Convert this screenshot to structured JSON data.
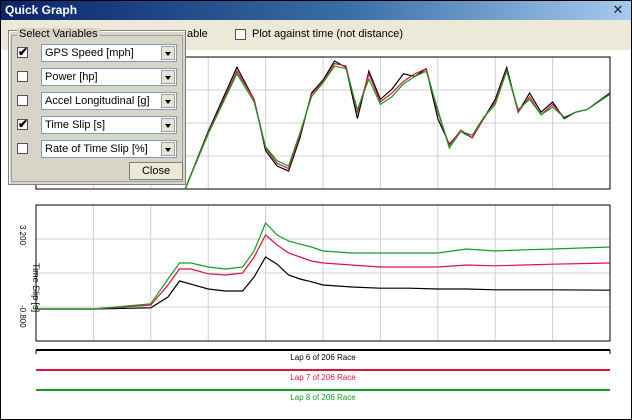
{
  "window": {
    "title": "Quick Graph",
    "close_glyph": "✕"
  },
  "toolbar": {
    "left_label_tail": "able",
    "time_checkbox_label": "Plot against time (not distance)",
    "time_checked": false
  },
  "select_panel": {
    "legend": "Select Variables",
    "variables": [
      {
        "label": "GPS Speed [mph]",
        "checked": true
      },
      {
        "label": "Power [hp]",
        "checked": false
      },
      {
        "label": "Accel Longitudinal [g]",
        "checked": false
      },
      {
        "label": "Time Slip [s]",
        "checked": true
      },
      {
        "label": "Rate of Time Slip [%]",
        "checked": false
      }
    ],
    "close_label": "Close"
  },
  "colors": {
    "lap6": "#000000",
    "lap7": "#e01040",
    "lap8": "#10a020"
  },
  "chart_data": [
    {
      "type": "line",
      "title": "",
      "ylabel": "",
      "series": [
        {
          "name": "Lap 6 of 206 Race",
          "color": "#000000",
          "x": [
            0.26,
            0.3,
            0.35,
            0.38,
            0.4,
            0.42,
            0.44,
            0.46,
            0.48,
            0.5,
            0.52,
            0.54,
            0.56,
            0.58,
            0.6,
            0.62,
            0.64,
            0.66,
            0.68,
            0.7,
            0.72,
            0.74,
            0.76,
            0.78,
            0.8,
            0.82,
            0.84,
            0.86,
            0.88,
            0.9,
            0.92,
            0.94,
            0.96,
            1.0
          ],
          "y": [
            0.0,
            0.45,
            0.95,
            0.7,
            0.3,
            0.18,
            0.14,
            0.4,
            0.75,
            0.85,
            1.0,
            0.95,
            0.55,
            0.92,
            0.7,
            0.78,
            0.9,
            0.88,
            0.94,
            0.55,
            0.35,
            0.45,
            0.4,
            0.55,
            0.7,
            0.95,
            0.6,
            0.75,
            0.6,
            0.68,
            0.55,
            0.6,
            0.62,
            0.75
          ]
        },
        {
          "name": "Lap 7 of 206 Race",
          "color": "#e01040",
          "x": [
            0.26,
            0.3,
            0.35,
            0.38,
            0.4,
            0.42,
            0.44,
            0.46,
            0.48,
            0.5,
            0.52,
            0.54,
            0.56,
            0.58,
            0.6,
            0.62,
            0.64,
            0.66,
            0.68,
            0.7,
            0.72,
            0.74,
            0.76,
            0.78,
            0.8,
            0.82,
            0.84,
            0.86,
            0.88,
            0.9,
            0.92,
            0.94,
            0.96,
            1.0
          ],
          "y": [
            0.0,
            0.44,
            0.92,
            0.7,
            0.32,
            0.2,
            0.16,
            0.42,
            0.74,
            0.84,
            0.98,
            0.96,
            0.6,
            0.9,
            0.68,
            0.75,
            0.84,
            0.9,
            0.94,
            0.6,
            0.34,
            0.46,
            0.4,
            0.55,
            0.68,
            0.93,
            0.6,
            0.72,
            0.58,
            0.66,
            0.56,
            0.6,
            0.62,
            0.74
          ]
        },
        {
          "name": "Lap 8 of 206 Race",
          "color": "#10a020",
          "x": [
            0.26,
            0.3,
            0.35,
            0.38,
            0.4,
            0.42,
            0.44,
            0.46,
            0.48,
            0.5,
            0.52,
            0.54,
            0.56,
            0.58,
            0.6,
            0.62,
            0.64,
            0.66,
            0.68,
            0.7,
            0.72,
            0.74,
            0.76,
            0.78,
            0.8,
            0.82,
            0.84,
            0.86,
            0.88,
            0.9,
            0.92,
            0.94,
            0.96,
            1.0
          ],
          "y": [
            0.0,
            0.43,
            0.9,
            0.68,
            0.33,
            0.22,
            0.18,
            0.44,
            0.72,
            0.83,
            0.96,
            0.94,
            0.62,
            0.86,
            0.66,
            0.72,
            0.82,
            0.88,
            0.92,
            0.62,
            0.32,
            0.45,
            0.42,
            0.56,
            0.66,
            0.92,
            0.62,
            0.7,
            0.58,
            0.64,
            0.56,
            0.6,
            0.62,
            0.74
          ]
        }
      ]
    },
    {
      "type": "line",
      "ylabel": "Time Slip [s]",
      "ytick_labels": [
        "3.200",
        "-0.800"
      ],
      "ylim": [
        -0.8,
        3.2
      ],
      "series": [
        {
          "name": "Lap 6 of 206 Race",
          "color": "#000000",
          "x": [
            0.0,
            0.1,
            0.2,
            0.23,
            0.25,
            0.27,
            0.3,
            0.33,
            0.36,
            0.38,
            0.4,
            0.42,
            0.44,
            0.46,
            0.48,
            0.5,
            0.55,
            0.6,
            0.65,
            0.7,
            0.75,
            0.8,
            0.85,
            0.9,
            1.0
          ],
          "y": [
            0.0,
            0.0,
            0.03,
            0.3,
            0.7,
            0.62,
            0.5,
            0.45,
            0.45,
            0.8,
            1.3,
            1.12,
            0.85,
            0.75,
            0.68,
            0.6,
            0.55,
            0.52,
            0.52,
            0.5,
            0.5,
            0.48,
            0.48,
            0.48,
            0.47
          ]
        },
        {
          "name": "Lap 7 of 206 Race",
          "color": "#e01040",
          "x": [
            0.0,
            0.1,
            0.2,
            0.23,
            0.25,
            0.27,
            0.3,
            0.33,
            0.36,
            0.38,
            0.4,
            0.42,
            0.44,
            0.46,
            0.48,
            0.5,
            0.55,
            0.6,
            0.65,
            0.7,
            0.75,
            0.8,
            0.85,
            0.9,
            1.0
          ],
          "y": [
            0.0,
            0.0,
            0.1,
            0.6,
            1.0,
            1.0,
            0.88,
            0.85,
            0.9,
            1.3,
            1.85,
            1.6,
            1.4,
            1.3,
            1.2,
            1.15,
            1.1,
            1.05,
            1.05,
            1.05,
            1.1,
            1.08,
            1.1,
            1.12,
            1.15
          ]
        },
        {
          "name": "Lap 8 of 206 Race",
          "color": "#10a020",
          "x": [
            0.0,
            0.1,
            0.2,
            0.23,
            0.25,
            0.27,
            0.3,
            0.33,
            0.36,
            0.38,
            0.4,
            0.42,
            0.44,
            0.46,
            0.48,
            0.5,
            0.55,
            0.6,
            0.65,
            0.7,
            0.75,
            0.8,
            0.85,
            0.9,
            1.0
          ],
          "y": [
            0.0,
            0.0,
            0.13,
            0.75,
            1.15,
            1.15,
            1.05,
            1.0,
            1.05,
            1.45,
            2.15,
            1.85,
            1.7,
            1.62,
            1.55,
            1.45,
            1.4,
            1.4,
            1.4,
            1.4,
            1.5,
            1.45,
            1.48,
            1.5,
            1.55
          ]
        }
      ]
    }
  ],
  "laps": [
    {
      "label": "Lap 6 of 206 Race",
      "color": "#000000"
    },
    {
      "label": "Lap 7 of 206 Race",
      "color": "#e01040"
    },
    {
      "label": "Lap 8 of 206 Race",
      "color": "#10a020"
    }
  ]
}
